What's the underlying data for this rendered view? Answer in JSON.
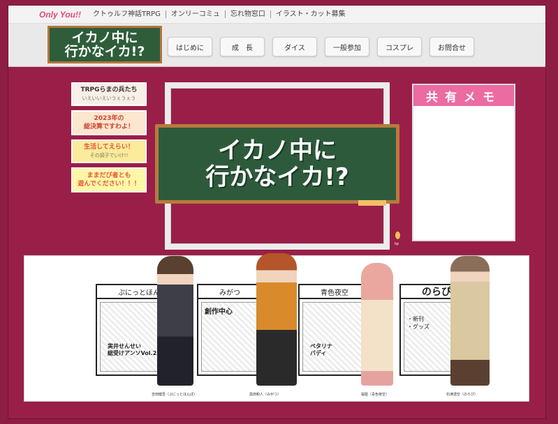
{
  "topbar": {
    "logo": "Only You!!",
    "links": [
      "クトゥルフ神話TRPG",
      "オンリーコミュ",
      "忘れ物窓口",
      "イラスト・カット募集"
    ]
  },
  "header": {
    "banner_line1": "イカノ中に",
    "banner_line2": "行かなイカ!?",
    "nav": [
      "はじめに",
      "成　長",
      "ダイス",
      "一般参加",
      "コスプレ",
      "お問合せ"
    ]
  },
  "side_buttons": [
    {
      "line1": "TRPGらまの兵たち",
      "line2": "いえいいえいうぇうぇう"
    },
    {
      "line1": "2023年の",
      "line2": "総決算ですわよ！"
    },
    {
      "line1": "生活してえらい！",
      "line2": "その調子でいけ!!"
    },
    {
      "line1": "ままだび者とも",
      "line2": "遊んでください！！！"
    }
  ],
  "main_banner": {
    "line1": "イカノ中に",
    "line2": "行かなイカ!?"
  },
  "memo": {
    "title": "共有メモ"
  },
  "pin_label": "kp",
  "cards": [
    {
      "title": "ぷにっとほんぽ",
      "body1": "実井せんせい",
      "body2": "総受けアンソVol.2!"
    },
    {
      "title": "みがつ",
      "body1": "創作中心",
      "body2": ""
    },
    {
      "title": "青色夜空",
      "body1": "ペタリナ",
      "body2": "バディ"
    },
    {
      "title": "のらぴ",
      "body1": "・新刊",
      "body2": "・グッズ"
    }
  ],
  "captions": [
    "吉田健吾（ぷにっとほんぽ）",
    "黒田和人（みがつ）",
    "桜庭（青色夜空）",
    "石津透空（のらぴ）"
  ],
  "colors": {
    "background": "#8e1d44",
    "accent": "#ec6ba0",
    "chalkboard": "#2e5a3c"
  }
}
